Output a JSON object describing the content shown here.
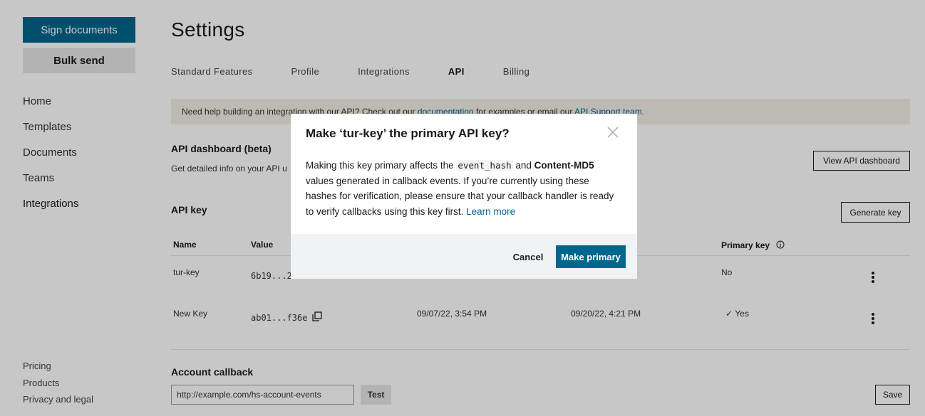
{
  "sidebar": {
    "sign_documents": "Sign documents",
    "bulk_send": "Bulk send",
    "nav": [
      "Home",
      "Templates",
      "Documents",
      "Teams",
      "Integrations"
    ],
    "footer": [
      "Pricing",
      "Products",
      "Privacy and legal"
    ]
  },
  "header": {
    "title": "Settings",
    "tabs": [
      "Standard Features",
      "Profile",
      "Integrations",
      "API",
      "Billing"
    ],
    "active_tab": "API"
  },
  "help_banner": {
    "text_1": "Need help building an integration with our API? Check out our ",
    "link_docs": "documentation",
    "text_2": " for examples or email our ",
    "link_support": "API Support team",
    "text_3": "."
  },
  "api_dashboard": {
    "title": "API dashboard (beta)",
    "subtitle": "Get detailed info on your API u",
    "button": "View API dashboard"
  },
  "api_key": {
    "title": "API key",
    "generate_button": "Generate key",
    "columns": {
      "name": "Name",
      "value": "Value",
      "primary": "Primary key"
    },
    "rows": [
      {
        "name": "tur-key",
        "value": "6b19...2",
        "created": "",
        "last_used": "",
        "primary": "No"
      },
      {
        "name": "New Key",
        "value": "ab01...f36e",
        "created": "09/07/22, 3:54 PM",
        "last_used": "09/20/22, 4:21 PM",
        "primary": "Yes"
      }
    ]
  },
  "account_callback": {
    "title": "Account callback",
    "url_value": "http://example.com/hs-account-events",
    "test_button": "Test",
    "save_button": "Save"
  },
  "modal": {
    "title": "Make ‘tur-key’ the primary API key?",
    "body_1": "Making this key primary affects the ",
    "code_1": "event_hash",
    "body_2": " and ",
    "bold_1": "Content-MD5",
    "body_3": " values generated in callback events. If you’re currently using these hashes for verification, please ensure that your callback handler is ready to verify callbacks using this key first. ",
    "learn_more": "Learn more",
    "cancel_button": "Cancel",
    "primary_button": "Make primary"
  },
  "colors": {
    "brand": "#00668c",
    "banner_bg": "#f1efe6",
    "modal_footer_bg": "#f0f3f5"
  }
}
